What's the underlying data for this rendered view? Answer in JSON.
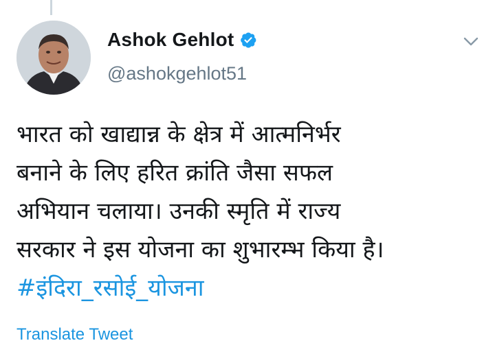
{
  "tweet": {
    "author": {
      "display_name": "Ashok Gehlot",
      "handle": "@ashokgehlot51",
      "verified": true,
      "verified_color": "#1da1f2"
    },
    "menu_icon": "chevron-down-icon",
    "text_lines": [
      "भारत को खाद्यान्न के क्षेत्र में आत्मनिर्भर",
      "बनाने के लिए हरित क्रांति जैसा सफल",
      "अभियान चलाया। उनकी स्मृति में राज्य",
      "सरकार ने इस योजना का शुभारम्भ किया है।"
    ],
    "hashtag": "#इंदिरा_रसोई_योजना",
    "hashtag_color": "#1b95e0",
    "translate_label": "Translate Tweet"
  }
}
